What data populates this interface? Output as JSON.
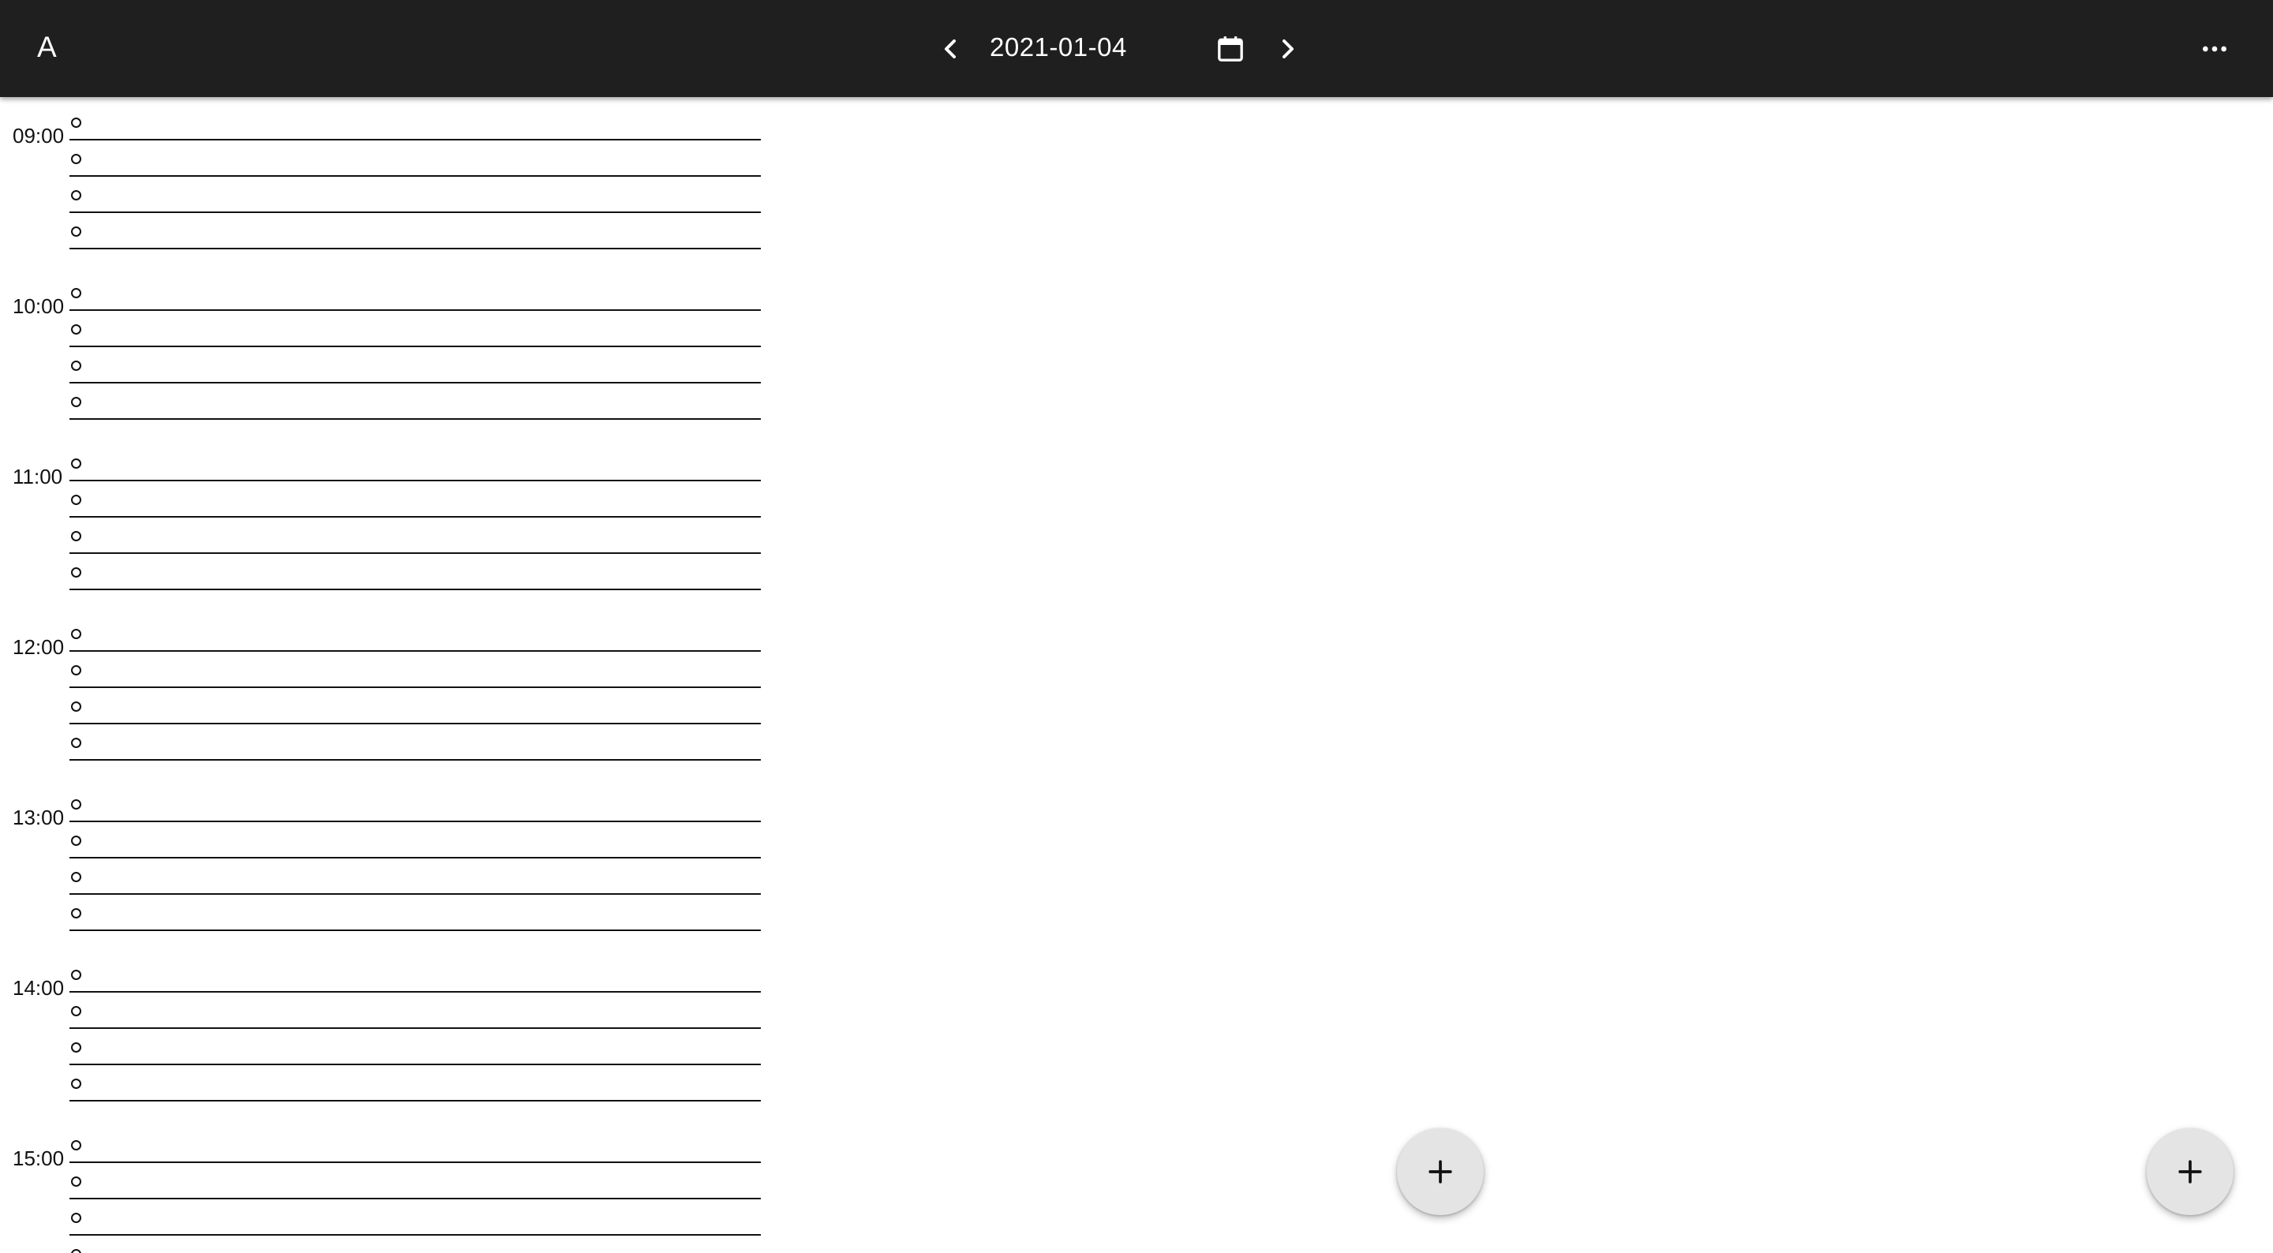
{
  "appbar": {
    "app_letter": "A",
    "date": "2021-01-04",
    "icons": {
      "prev": "chevron-left-icon",
      "calendar": "calendar-icon",
      "next": "chevron-right-icon",
      "more": "more-horizontal-icon"
    }
  },
  "schedule": {
    "hours": [
      {
        "label": "09:00",
        "slots": [
          "",
          "",
          "",
          ""
        ]
      },
      {
        "label": "10:00",
        "slots": [
          "",
          "",
          "",
          ""
        ]
      },
      {
        "label": "11:00",
        "slots": [
          "",
          "",
          "",
          ""
        ]
      },
      {
        "label": "12:00",
        "slots": [
          "",
          "",
          "",
          ""
        ]
      },
      {
        "label": "13:00",
        "slots": [
          "",
          "",
          "",
          ""
        ]
      },
      {
        "label": "14:00",
        "slots": [
          "",
          "",
          "",
          ""
        ]
      },
      {
        "label": "15:00",
        "slots": [
          "",
          "",
          "",
          ""
        ]
      }
    ]
  },
  "fabs": [
    {
      "icon": "plus-icon"
    },
    {
      "icon": "plus-icon"
    }
  ],
  "colors": {
    "appbar_bg": "#1f1f1f",
    "appbar_text": "#ffffff",
    "fab_bg": "#e4e4e4",
    "line": "#111111"
  }
}
